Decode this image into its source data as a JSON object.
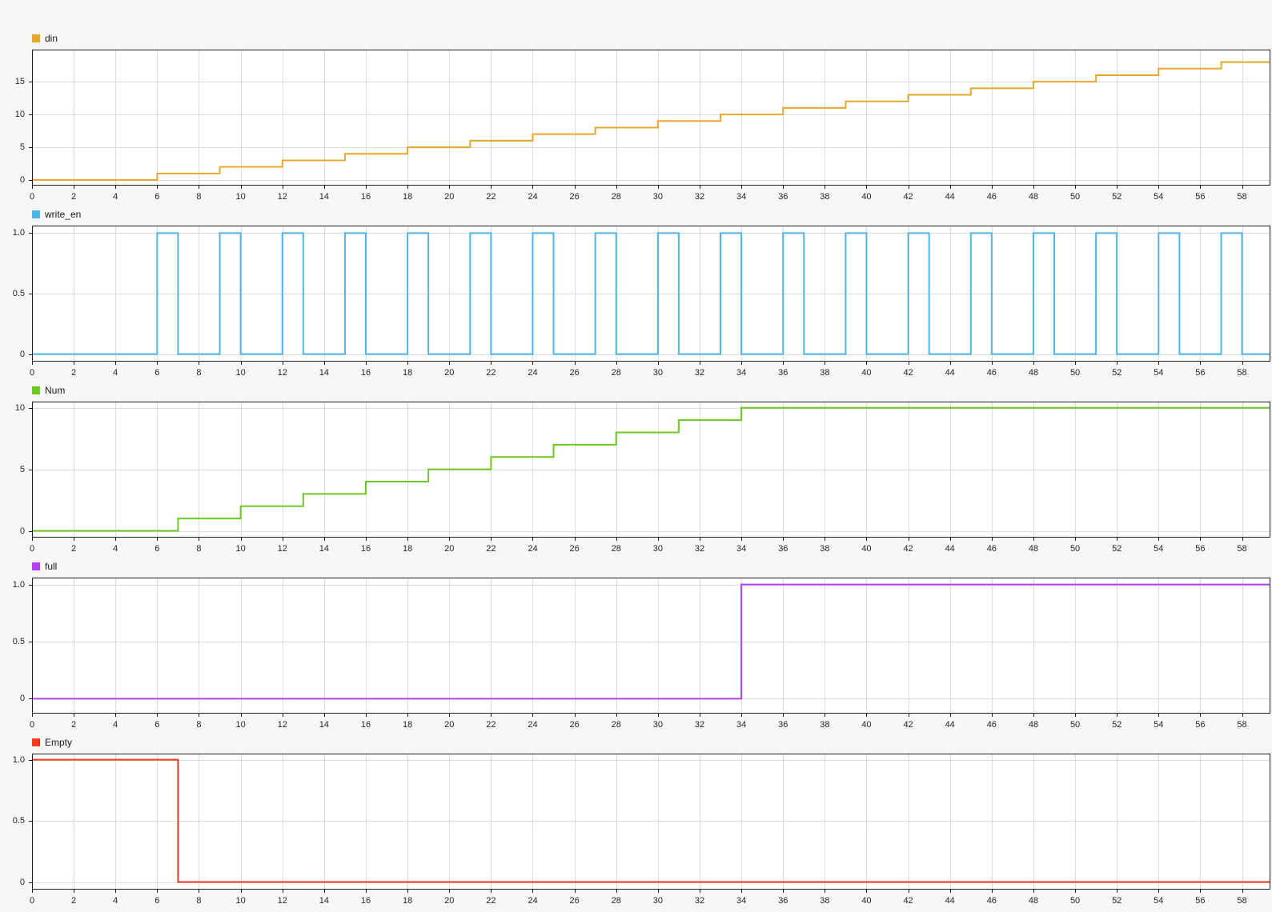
{
  "page": {
    "background": "#f7f7f7",
    "plot_background": "#ffffff",
    "grid_color": "#dcdcdc",
    "axis_color": "#1f1f1f",
    "tick_label_color": "#262626"
  },
  "chart_data": [
    {
      "type": "line",
      "line_style": "step",
      "title": "din",
      "color": "#E8A82B",
      "x": [
        0,
        6,
        9,
        12,
        15,
        18,
        21,
        24,
        27,
        30,
        33,
        36,
        39,
        42,
        45,
        48,
        51,
        54,
        57
      ],
      "y": [
        0,
        1,
        2,
        3,
        4,
        5,
        6,
        7,
        8,
        9,
        10,
        11,
        12,
        13,
        14,
        15,
        16,
        17,
        18
      ],
      "x_end": 59.36,
      "xlim": [
        0,
        59.36
      ],
      "ylim": [
        -0.85,
        19.9
      ],
      "xticks": [
        0,
        2,
        4,
        6,
        8,
        10,
        12,
        14,
        16,
        18,
        20,
        22,
        24,
        26,
        28,
        30,
        32,
        34,
        36,
        38,
        40,
        42,
        44,
        46,
        48,
        50,
        52,
        54,
        56,
        58
      ],
      "yticks": [
        0,
        5,
        10,
        15
      ],
      "ytick_labels": [
        "0",
        "5",
        "10",
        "15"
      ],
      "grid": true,
      "legend_position": "top-left"
    },
    {
      "type": "line",
      "line_style": "step",
      "title": "write_en",
      "color": "#4FB5E7",
      "x": [
        0,
        6,
        7,
        9,
        10,
        12,
        13,
        15,
        16,
        18,
        19,
        21,
        22,
        24,
        25,
        27,
        28,
        30,
        31,
        33,
        34,
        36,
        37,
        39,
        40,
        42,
        43,
        45,
        46,
        48,
        49,
        51,
        52,
        54,
        55,
        57,
        58
      ],
      "y": [
        0,
        1,
        0,
        1,
        0,
        1,
        0,
        1,
        0,
        1,
        0,
        1,
        0,
        1,
        0,
        1,
        0,
        1,
        0,
        1,
        0,
        1,
        0,
        1,
        0,
        1,
        0,
        1,
        0,
        1,
        0,
        1,
        0,
        1,
        0,
        1,
        0
      ],
      "x_end": 59.36,
      "xlim": [
        0,
        59.36
      ],
      "ylim": [
        -0.062,
        1.062
      ],
      "xticks": [
        0,
        2,
        4,
        6,
        8,
        10,
        12,
        14,
        16,
        18,
        20,
        22,
        24,
        26,
        28,
        30,
        32,
        34,
        36,
        38,
        40,
        42,
        44,
        46,
        48,
        50,
        52,
        54,
        56,
        58
      ],
      "yticks": [
        0,
        0.5,
        1
      ],
      "ytick_labels": [
        "0",
        "0.5",
        "1.0"
      ],
      "grid": true,
      "legend_position": "top-left"
    },
    {
      "type": "line",
      "line_style": "step",
      "title": "Num",
      "color": "#6CC823",
      "x": [
        0,
        7,
        10,
        13,
        16,
        19,
        22,
        25,
        28,
        31,
        34
      ],
      "y": [
        0,
        1,
        2,
        3,
        4,
        5,
        6,
        7,
        8,
        9,
        10
      ],
      "x_end": 59.36,
      "xlim": [
        0,
        59.36
      ],
      "ylim": [
        -0.55,
        10.5
      ],
      "xticks": [
        0,
        2,
        4,
        6,
        8,
        10,
        12,
        14,
        16,
        18,
        20,
        22,
        24,
        26,
        28,
        30,
        32,
        34,
        36,
        38,
        40,
        42,
        44,
        46,
        48,
        50,
        52,
        54,
        56,
        58
      ],
      "yticks": [
        0,
        5,
        10
      ],
      "ytick_labels": [
        "0",
        "5",
        "10"
      ],
      "grid": true,
      "legend_position": "top-left"
    },
    {
      "type": "line",
      "line_style": "step",
      "title": "full",
      "color": "#B342F0",
      "x": [
        0,
        34
      ],
      "y": [
        0,
        1
      ],
      "x_end": 59.36,
      "xlim": [
        0,
        59.36
      ],
      "ylim": [
        -0.13,
        1.06
      ],
      "xticks": [
        0,
        2,
        4,
        6,
        8,
        10,
        12,
        14,
        16,
        18,
        20,
        22,
        24,
        26,
        28,
        30,
        32,
        34,
        36,
        38,
        40,
        42,
        44,
        46,
        48,
        50,
        52,
        54,
        56,
        58
      ],
      "yticks": [
        0,
        0.5,
        1
      ],
      "ytick_labels": [
        "0",
        "0.5",
        "1.0"
      ],
      "grid": true,
      "legend_position": "top-left"
    },
    {
      "type": "line",
      "line_style": "step",
      "title": "Empty",
      "color": "#F23A1A",
      "x": [
        0,
        7
      ],
      "y": [
        1,
        0
      ],
      "x_end": 59.36,
      "xlim": [
        0,
        59.36
      ],
      "ylim": [
        -0.062,
        1.05
      ],
      "xticks": [
        0,
        2,
        4,
        6,
        8,
        10,
        12,
        14,
        16,
        18,
        20,
        22,
        24,
        26,
        28,
        30,
        32,
        34,
        36,
        38,
        40,
        42,
        44,
        46,
        48,
        50,
        52,
        54,
        56,
        58
      ],
      "yticks": [
        0,
        0.5,
        1
      ],
      "ytick_labels": [
        "0",
        "0.5",
        "1.0"
      ],
      "grid": true,
      "legend_position": "top-left"
    }
  ]
}
